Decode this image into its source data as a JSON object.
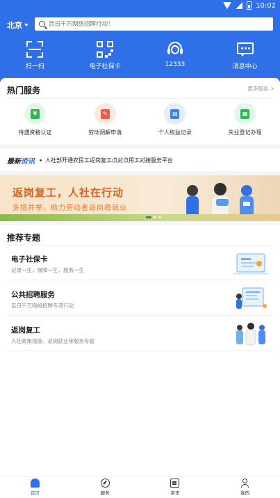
{
  "status_bar": {
    "time": "10:02",
    "icons": [
      "wifi-icon",
      "signal-icon",
      "battery-icon"
    ]
  },
  "header": {
    "city": "北京",
    "search_placeholder": "百日千万网络招聘行动！",
    "quick_actions": [
      {
        "label": "扫一扫",
        "icon": "scan-icon"
      },
      {
        "label": "电子社保卡",
        "icon": "qr-code-icon"
      },
      {
        "label": "12333",
        "icon": "headset-icon"
      },
      {
        "label": "消息中心",
        "icon": "message-icon"
      }
    ]
  },
  "hot_services": {
    "title": "热门服务",
    "more": "更多服务 >",
    "items": [
      {
        "label": "待遇资格认证",
        "icon": "wallet-icon",
        "glyph": "¥",
        "bg": "#e4f6e7",
        "fg": "#2fb552"
      },
      {
        "label": "劳动调解申请",
        "icon": "document-icon",
        "glyph": "✎",
        "bg": "#fde8e3",
        "fg": "#ef5a44"
      },
      {
        "label": "个人权益记录",
        "icon": "id-card-icon",
        "glyph": "▤",
        "bg": "#e3edfd",
        "fg": "#3b82f0"
      },
      {
        "label": "失业登记办理",
        "icon": "register-icon",
        "glyph": "▦",
        "bg": "#e4f6e7",
        "fg": "#2fb552"
      }
    ]
  },
  "news": {
    "tag_prefix": "最新",
    "tag_highlight": "资讯",
    "headline": "人社部开通农民工返岗复工点对点用工对接服务平台"
  },
  "banner": {
    "title": "返岗复工，人社在行动",
    "subtitle": "多措并举，助力劳动者返岗稳就业",
    "pages": 3,
    "active_page": 1
  },
  "recommended": {
    "title": "推荐专题",
    "topics": [
      {
        "title": "电子社保卡",
        "subtitle": "记录一生，保障一生，服务一生"
      },
      {
        "title": "公共招聘服务",
        "subtitle": "百日千万网络招聘专项行动"
      },
      {
        "title": "返岗复工",
        "subtitle": "人社政策措施、返岗就业等服务专题"
      }
    ]
  },
  "bottom_nav": [
    {
      "label": "首页",
      "icon": "home-icon",
      "active": true
    },
    {
      "label": "服务",
      "icon": "compass-icon",
      "active": false
    },
    {
      "label": "资讯",
      "icon": "news-icon",
      "active": false
    },
    {
      "label": "我的",
      "icon": "profile-icon",
      "active": false
    }
  ],
  "colors": {
    "primary": "#2f6fe8",
    "banner_text": "#d6621e"
  }
}
